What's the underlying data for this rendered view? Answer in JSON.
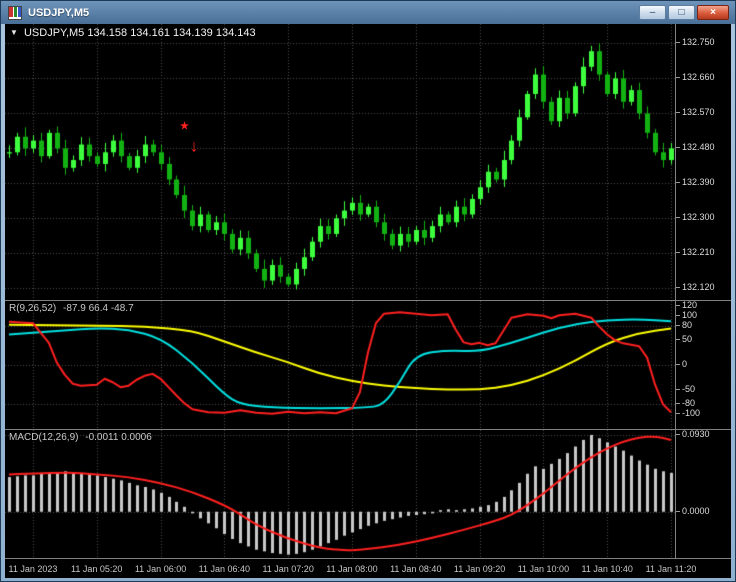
{
  "window": {
    "title": "USDJPY,M5",
    "buttons": [
      {
        "name": "minimize-button",
        "glyph": "–"
      },
      {
        "name": "restore-button",
        "glyph": "□"
      },
      {
        "name": "close-button",
        "glyph": "×"
      }
    ]
  },
  "chart": {
    "info": {
      "dropdown": "▼",
      "symbol": "USDJPY,M5",
      "ohlc": "134.158 134.161 134.139 134.143"
    }
  },
  "theme": {
    "bg": "#000000",
    "grid": "#4d4d4d",
    "bull": "#3dff3d",
    "bear": "#12b212",
    "separator": "#808080",
    "axis_text": "#dcdcdc"
  },
  "time_axis": [
    {
      "label": "11 Jan 2023",
      "index": 3
    },
    {
      "label": "11 Jan 05:20",
      "index": 11
    },
    {
      "label": "11 Jan 06:00",
      "index": 19
    },
    {
      "label": "11 Jan 06:40",
      "index": 27
    },
    {
      "label": "11 Jan 07:20",
      "index": 35
    },
    {
      "label": "11 Jan 08:00",
      "index": 43
    },
    {
      "label": "11 Jan 08:40",
      "index": 51
    },
    {
      "label": "11 Jan 09:20",
      "index": 59
    },
    {
      "label": "11 Jan 10:00",
      "index": 67
    },
    {
      "label": "11 Jan 10:40",
      "index": 75
    },
    {
      "label": "11 Jan 11:20",
      "index": 83
    }
  ],
  "chart_data": [
    {
      "type": "candlestick",
      "symbol": "USDJPY",
      "timeframe": "M5",
      "quote_line": "USDJPY,M5 134.158 134.161 134.139 134.143",
      "price_ticks": [
        "132.750",
        "132.660",
        "132.570",
        "132.480",
        "132.390",
        "132.300",
        "132.210",
        "132.120"
      ],
      "price_range": [
        132.09,
        132.8
      ],
      "first_open": 132.47,
      "wick_pattern": [
        0.018,
        0.01,
        0.024,
        0.014,
        0.02,
        0.008,
        0.016,
        0.022,
        0.012,
        0.019
      ],
      "closes": [
        132.47,
        132.51,
        132.48,
        132.5,
        132.46,
        132.52,
        132.48,
        132.43,
        132.45,
        132.49,
        132.46,
        132.44,
        132.47,
        132.5,
        132.46,
        132.43,
        132.46,
        132.49,
        132.47,
        132.44,
        132.4,
        132.36,
        132.32,
        132.28,
        132.31,
        132.27,
        132.29,
        132.26,
        132.22,
        132.25,
        132.21,
        132.17,
        132.14,
        132.18,
        132.15,
        132.13,
        132.17,
        132.2,
        132.24,
        132.28,
        132.26,
        132.3,
        132.32,
        132.34,
        132.31,
        132.33,
        132.29,
        132.26,
        132.23,
        132.26,
        132.24,
        132.27,
        132.25,
        132.28,
        132.31,
        132.29,
        132.33,
        132.31,
        132.35,
        132.38,
        132.42,
        132.4,
        132.45,
        132.5,
        132.56,
        132.62,
        132.67,
        132.6,
        132.55,
        132.61,
        132.57,
        132.64,
        132.69,
        132.73,
        132.67,
        132.62,
        132.66,
        132.6,
        132.63,
        132.57,
        132.52,
        132.47,
        132.45,
        132.48
      ],
      "annotations": [
        {
          "name": "star-marker",
          "glyph": "★",
          "color": "#ff2020",
          "index": 22,
          "price": 132.535,
          "size": 10
        },
        {
          "name": "sell-arrow",
          "glyph": "↓",
          "color": "#ff2020",
          "index": 23.2,
          "price": 132.487,
          "size": 17
        }
      ]
    },
    {
      "type": "line",
      "label_name": "R(9,26,52)",
      "label_values": "-87.9 66.4 -48.7",
      "range": [
        -130,
        130
      ],
      "ticks": [
        120,
        100,
        80,
        50,
        0,
        -50,
        -80,
        -100
      ],
      "level_lines": [
        80,
        0,
        -80
      ],
      "series": [
        {
          "name": "slow-line",
          "color": "#ffff00",
          "smooth": true,
          "points": [
            [
              0,
              82
            ],
            [
              11,
              80
            ],
            [
              17,
              78
            ],
            [
              23,
              70
            ],
            [
              27,
              48
            ],
            [
              31,
              25
            ],
            [
              35,
              6
            ],
            [
              39,
              -18
            ],
            [
              43,
              -33
            ],
            [
              47,
              -42
            ],
            [
              51,
              -47
            ],
            [
              55,
              -50
            ],
            [
              59,
              -50
            ],
            [
              63,
              -42
            ],
            [
              67,
              -22
            ],
            [
              71,
              8
            ],
            [
              75,
              45
            ],
            [
              79,
              65
            ],
            [
              83,
              74
            ]
          ]
        },
        {
          "name": "mid-line",
          "color": "#00e0e0",
          "smooth": true,
          "points": [
            [
              0,
              62
            ],
            [
              7,
              70
            ],
            [
              11,
              75
            ],
            [
              15,
              72
            ],
            [
              19,
              55
            ],
            [
              23,
              5
            ],
            [
              27,
              -60
            ],
            [
              29,
              -80
            ],
            [
              33,
              -87
            ],
            [
              39,
              -88
            ],
            [
              45,
              -87
            ],
            [
              47,
              -80
            ],
            [
              49,
              -35
            ],
            [
              51,
              22
            ],
            [
              55,
              30
            ],
            [
              59,
              27
            ],
            [
              63,
              45
            ],
            [
              67,
              66
            ],
            [
              71,
              84
            ],
            [
              75,
              91
            ],
            [
              79,
              93
            ],
            [
              83,
              89
            ]
          ]
        },
        {
          "name": "fast-line",
          "color": "#ff2020",
          "smooth": false,
          "points": [
            [
              0,
              88
            ],
            [
              3,
              85
            ],
            [
              5,
              45
            ],
            [
              6,
              5
            ],
            [
              7,
              -20
            ],
            [
              8,
              -38
            ],
            [
              9,
              -42
            ],
            [
              11,
              -40
            ],
            [
              12,
              -28
            ],
            [
              13,
              -35
            ],
            [
              14,
              -45
            ],
            [
              15,
              -42
            ],
            [
              16,
              -30
            ],
            [
              17,
              -22
            ],
            [
              18,
              -18
            ],
            [
              19,
              -28
            ],
            [
              20,
              -45
            ],
            [
              21,
              -62
            ],
            [
              22,
              -78
            ],
            [
              23,
              -90
            ],
            [
              25,
              -96
            ],
            [
              27,
              -97
            ],
            [
              29,
              -92
            ],
            [
              31,
              -97
            ],
            [
              33,
              -99
            ],
            [
              35,
              -95
            ],
            [
              37,
              -98
            ],
            [
              39,
              -96
            ],
            [
              41,
              -98
            ],
            [
              43,
              -88
            ],
            [
              44,
              -55
            ],
            [
              45,
              25
            ],
            [
              46,
              85
            ],
            [
              47,
              104
            ],
            [
              49,
              107
            ],
            [
              51,
              104
            ],
            [
              53,
              101
            ],
            [
              55,
              103
            ],
            [
              56,
              72
            ],
            [
              57,
              46
            ],
            [
              58,
              42
            ],
            [
              59,
              45
            ],
            [
              60,
              40
            ],
            [
              61,
              44
            ],
            [
              62,
              70
            ],
            [
              63,
              96
            ],
            [
              65,
              103
            ],
            [
              67,
              100
            ],
            [
              68,
              95
            ],
            [
              69,
              101
            ],
            [
              71,
              104
            ],
            [
              72,
              100
            ],
            [
              73,
              96
            ],
            [
              74,
              78
            ],
            [
              75,
              62
            ],
            [
              76,
              50
            ],
            [
              77,
              44
            ],
            [
              78,
              41
            ],
            [
              79,
              38
            ],
            [
              80,
              15
            ],
            [
              81,
              -40
            ],
            [
              82,
              -80
            ],
            [
              83,
              -96
            ]
          ]
        }
      ]
    },
    {
      "type": "macd",
      "label_name": "MACD(12,26,9)",
      "label_values": "-0.0011 0.0006",
      "range": [
        -0.056,
        0.099
      ],
      "ticks": [
        {
          "v": 0.093,
          "label": "0.0930"
        },
        {
          "v": 0,
          "label": "0.0000"
        }
      ],
      "level_lines": [
        0.093,
        0
      ],
      "bar_color": "#c8c8c8",
      "histogram": [
        0.042,
        0.043,
        0.044,
        0.044,
        0.046,
        0.047,
        0.048,
        0.049,
        0.048,
        0.047,
        0.046,
        0.044,
        0.042,
        0.04,
        0.038,
        0.035,
        0.032,
        0.03,
        0.027,
        0.023,
        0.018,
        0.012,
        0.006,
        -0.002,
        -0.008,
        -0.014,
        -0.02,
        -0.027,
        -0.033,
        -0.038,
        -0.042,
        -0.046,
        -0.048,
        -0.05,
        -0.051,
        -0.052,
        -0.051,
        -0.049,
        -0.046,
        -0.042,
        -0.038,
        -0.034,
        -0.029,
        -0.025,
        -0.021,
        -0.017,
        -0.014,
        -0.011,
        -0.009,
        -0.007,
        -0.005,
        -0.004,
        -0.003,
        -0.002,
        0.002,
        0.003,
        0.002,
        0.003,
        0.004,
        0.006,
        0.008,
        0.012,
        0.018,
        0.026,
        0.035,
        0.046,
        0.055,
        0.052,
        0.058,
        0.064,
        0.071,
        0.079,
        0.087,
        0.093,
        0.089,
        0.084,
        0.079,
        0.074,
        0.068,
        0.062,
        0.057,
        0.052,
        0.049,
        0.047
      ],
      "signal": {
        "name": "signal-line",
        "color": "#ff2020",
        "smooth": true,
        "points": [
          [
            0,
            0.045
          ],
          [
            7,
            0.048
          ],
          [
            11,
            0.0455
          ],
          [
            15,
            0.042
          ],
          [
            19,
            0.035
          ],
          [
            23,
            0.024
          ],
          [
            27,
            0.008
          ],
          [
            29,
            -0.003
          ],
          [
            31,
            -0.016
          ],
          [
            35,
            -0.033
          ],
          [
            39,
            -0.044
          ],
          [
            42,
            -0.047
          ],
          [
            45,
            -0.0455
          ],
          [
            49,
            -0.04
          ],
          [
            53,
            -0.032
          ],
          [
            57,
            -0.022
          ],
          [
            61,
            -0.011
          ],
          [
            63,
            -0.004
          ],
          [
            65,
            0.008
          ],
          [
            67,
            0.022
          ],
          [
            69,
            0.038
          ],
          [
            71,
            0.053
          ],
          [
            73,
            0.066
          ],
          [
            75,
            0.077
          ],
          [
            77,
            0.085
          ],
          [
            79,
            0.09
          ],
          [
            81,
            0.0915
          ],
          [
            83,
            0.087
          ]
        ]
      }
    }
  ]
}
